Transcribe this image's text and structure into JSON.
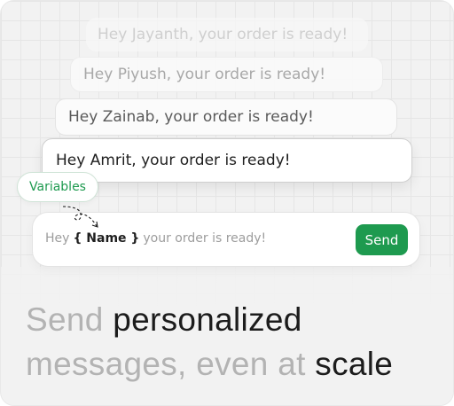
{
  "messages": [
    "Hey Jayanth, your order is ready!",
    "Hey Piyush, your order is ready!",
    "Hey Zainab, your order is ready!",
    "Hey Amrit, your order is ready!"
  ],
  "variables_label": "Variables",
  "composer": {
    "prefix": "Hey",
    "variable": "{ Name }",
    "suffix": "your order is ready!",
    "send_label": "Send"
  },
  "headline": {
    "line1_muted": "Send",
    "line1_strong": "personalized",
    "line2_muted": "messages, even at",
    "line2_strong": "scale"
  },
  "colors": {
    "accent": "#1e9a4f",
    "muted_text": "#b3b3b3",
    "strong_text": "#1c1c1c"
  }
}
